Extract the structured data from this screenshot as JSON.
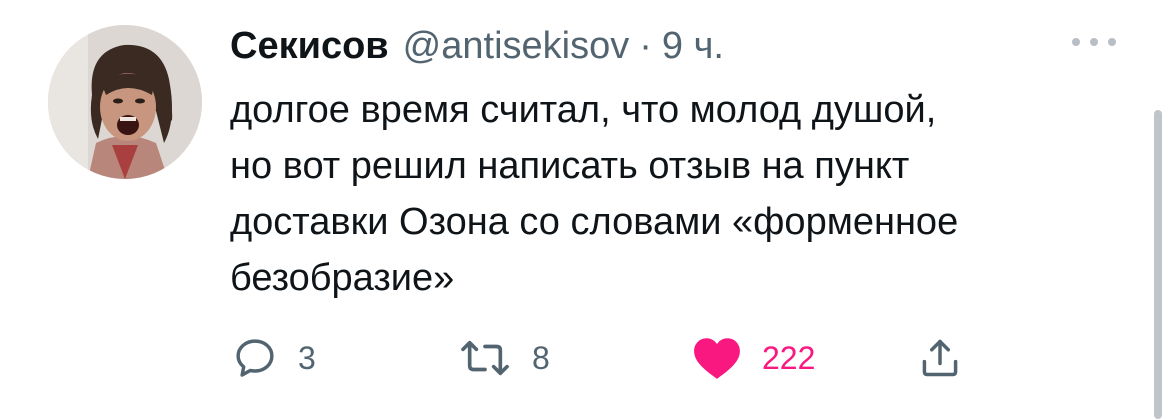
{
  "author": {
    "name": "Секисов",
    "handle": "@antisekisov",
    "separator": "·",
    "time": "9 ч."
  },
  "tweet": {
    "lines": [
      "долгое время считал, что молод душой,",
      "но вот решил написать отзыв на пункт",
      "доставки Озона со словами «форменное",
      "безобразие»"
    ]
  },
  "actions": {
    "reply_count": "3",
    "retweet_count": "8",
    "like_count": "222",
    "liked": true
  },
  "icons": {
    "reply": "speech-bubble-icon",
    "retweet": "retweet-arrows-icon",
    "like": "heart-icon",
    "share": "share-upload-icon",
    "more": "more-dots-icon"
  },
  "colors": {
    "text": "#0f1419",
    "muted": "#536471",
    "like": "#f91880"
  }
}
